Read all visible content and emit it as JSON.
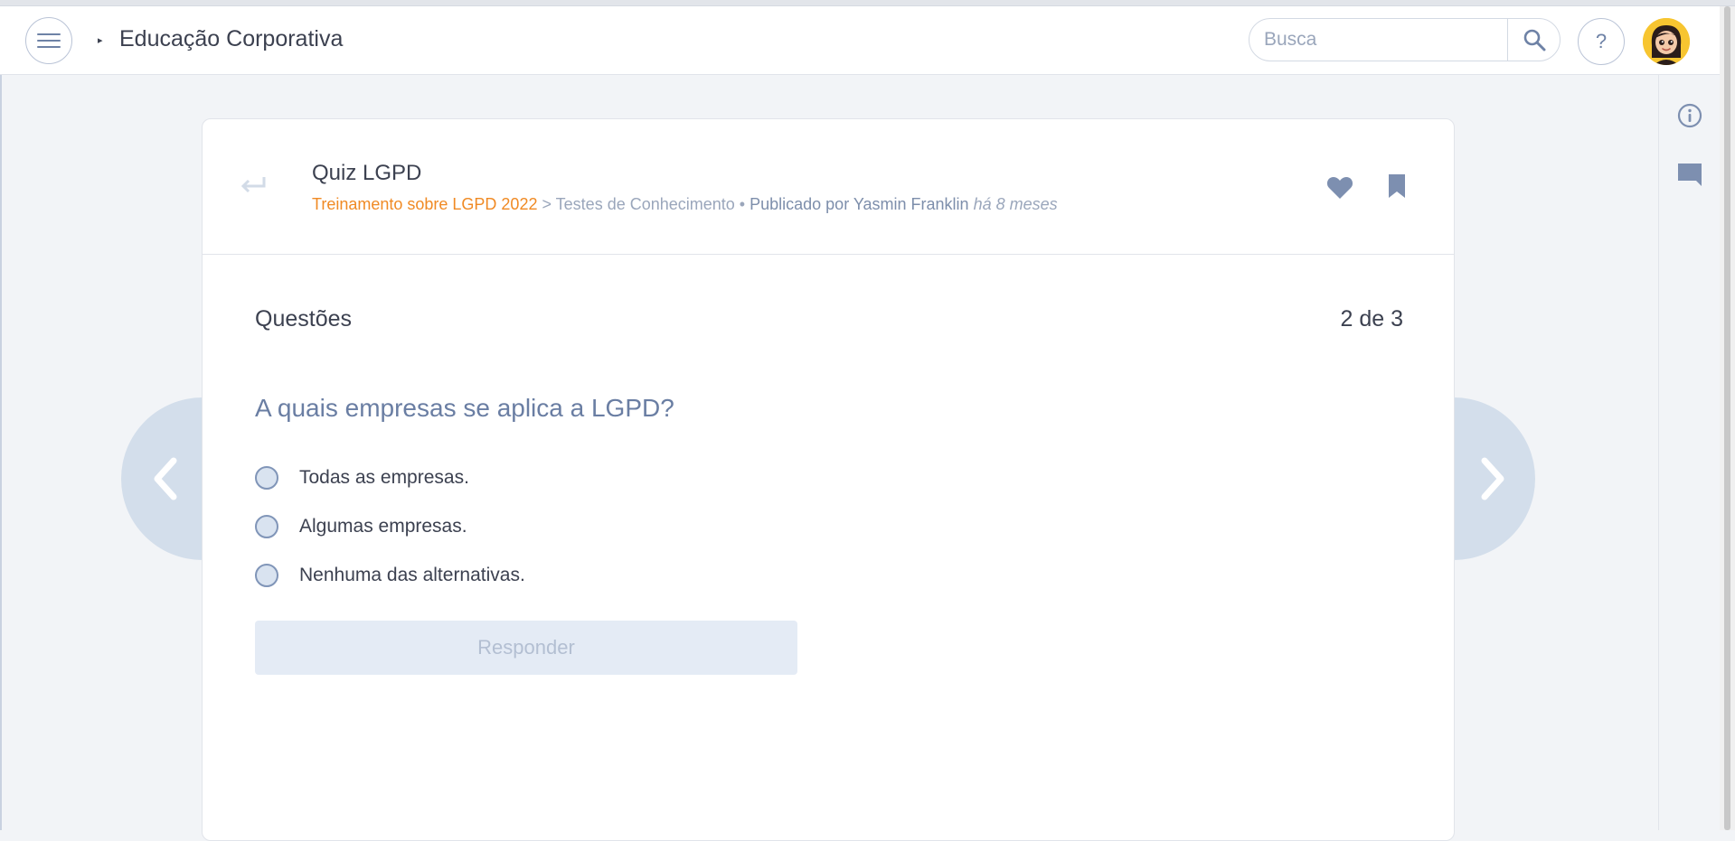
{
  "header": {
    "app_title": "Educação Corporativa",
    "search_placeholder": "Busca",
    "help_label": "?"
  },
  "post": {
    "title": "Quiz LGPD",
    "course": "Treinamento sobre LGPD 2022",
    "separator": " > ",
    "section": "Testes de Conhecimento",
    "bullet": " • ",
    "published_by": "Publicado por Yasmin Franklin",
    "time_ago": "há 8 meses"
  },
  "quiz": {
    "label": "Questões",
    "counter": "2 de 3",
    "question": "A quais empresas se aplica a LGPD?",
    "options": [
      "Todas as empresas.",
      "Algumas empresas.",
      "Nenhuma das alternativas."
    ],
    "submit_label": "Responder"
  },
  "colors": {
    "accent_orange": "#f08a24",
    "nav_circle": "#d3deeb",
    "icon_blue": "#7d8fb0"
  }
}
